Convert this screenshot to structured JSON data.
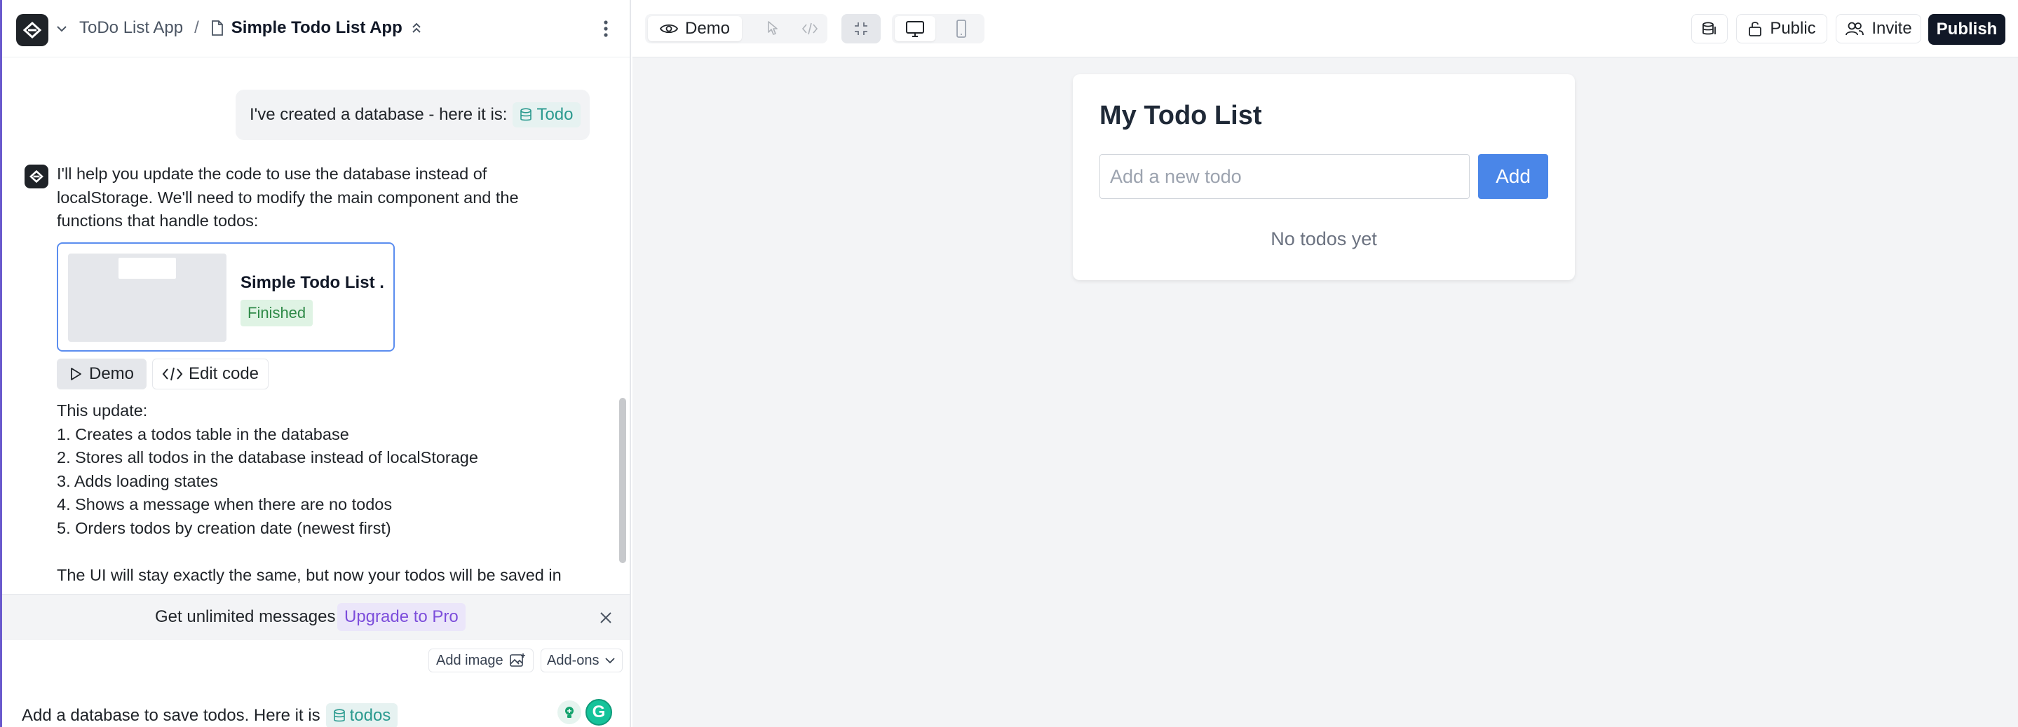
{
  "header": {
    "project": "ToDo List App",
    "separator": "/",
    "document": "Simple Todo List App"
  },
  "chat": {
    "user_message": {
      "text": "I've created a database - here it is:",
      "chip": "Todo"
    },
    "assistant": {
      "intro_lines": [
        "I'll help you update the code to use the database instead of",
        "localStorage. We'll need to modify the main component and the",
        "functions that handle todos:"
      ],
      "card": {
        "title": "Simple Todo List ...",
        "status": "Finished"
      },
      "demo_label": "Demo",
      "edit_label": "Edit code",
      "update_lines": [
        "This update:",
        "1. Creates a todos table in the database",
        "2. Stores all todos in the database instead of localStorage",
        "3. Adds loading states",
        "4. Shows a message when there are no todos",
        "5. Orders todos by creation date (newest first)",
        "",
        "The UI will stay exactly the same, but now your todos will be saved in"
      ]
    }
  },
  "upgrade": {
    "text": "Get unlimited messages",
    "link": "Upgrade to Pro"
  },
  "composer": {
    "add_image": "Add image",
    "addons": "Add-ons",
    "text": "Add a database to save todos. Here it is",
    "chip": "todos"
  },
  "toolbar": {
    "demo_tab": "Demo",
    "public": "Public",
    "invite": "Invite",
    "publish": "Publish"
  },
  "app": {
    "title": "My Todo List",
    "placeholder": "Add a new todo",
    "add_button": "Add",
    "empty": "No todos yet"
  },
  "colors": {
    "accent_blue": "#4a86e8",
    "publish_bg": "#111827",
    "chip_teal": "#2b9a8f",
    "upgrade_purple": "#7c4ddb",
    "finished_green": "#2f8a48"
  }
}
